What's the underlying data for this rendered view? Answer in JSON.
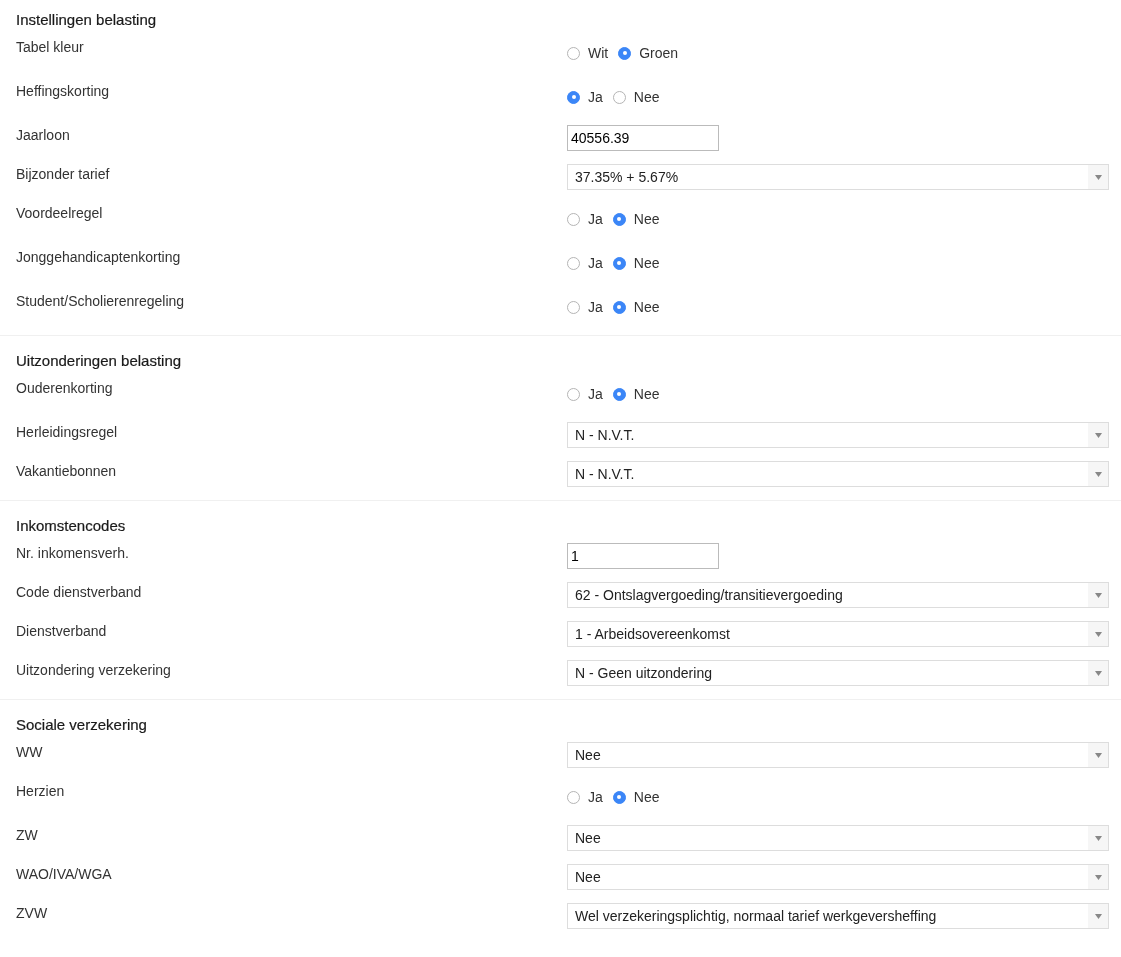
{
  "sections": [
    {
      "title": "Instellingen belasting",
      "rows": [
        {
          "label": "Tabel kleur",
          "kind": "radio",
          "options": [
            {
              "label": "Wit",
              "selected": false
            },
            {
              "label": "Groen",
              "selected": true
            }
          ]
        },
        {
          "label": "Heffingskorting",
          "kind": "radio",
          "options": [
            {
              "label": "Ja",
              "selected": true
            },
            {
              "label": "Nee",
              "selected": false
            }
          ]
        },
        {
          "label": "Jaarloon",
          "kind": "text",
          "value": "40556.39"
        },
        {
          "label": "Bijzonder tarief",
          "kind": "select",
          "value": "37.35% + 5.67%"
        },
        {
          "label": "Voordeelregel",
          "kind": "radio",
          "options": [
            {
              "label": "Ja",
              "selected": false
            },
            {
              "label": "Nee",
              "selected": true
            }
          ]
        },
        {
          "label": "Jonggehandicaptenkorting",
          "kind": "radio",
          "options": [
            {
              "label": "Ja",
              "selected": false
            },
            {
              "label": "Nee",
              "selected": true
            }
          ]
        },
        {
          "label": "Student/Scholierenregeling",
          "kind": "radio",
          "options": [
            {
              "label": "Ja",
              "selected": false
            },
            {
              "label": "Nee",
              "selected": true
            }
          ]
        }
      ]
    },
    {
      "title": "Uitzonderingen belasting",
      "rows": [
        {
          "label": "Ouderenkorting",
          "kind": "radio",
          "options": [
            {
              "label": "Ja",
              "selected": false
            },
            {
              "label": "Nee",
              "selected": true
            }
          ]
        },
        {
          "label": "Herleidingsregel",
          "kind": "select",
          "value": "N - N.V.T."
        },
        {
          "label": "Vakantiebonnen",
          "kind": "select",
          "value": "N - N.V.T."
        }
      ]
    },
    {
      "title": "Inkomstencodes",
      "rows": [
        {
          "label": "Nr. inkomensverh.",
          "kind": "text",
          "value": "1"
        },
        {
          "label": "Code dienstverband",
          "kind": "select",
          "value": "62 - Ontslagvergoeding/transitievergoeding"
        },
        {
          "label": "Dienstverband",
          "kind": "select",
          "value": "1 - Arbeidsovereenkomst"
        },
        {
          "label": "Uitzondering verzekering",
          "kind": "select",
          "value": "N - Geen uitzondering"
        }
      ]
    },
    {
      "title": "Sociale verzekering",
      "rows": [
        {
          "label": "WW",
          "kind": "select",
          "value": "Nee"
        },
        {
          "label": "Herzien",
          "kind": "radio",
          "options": [
            {
              "label": "Ja",
              "selected": false
            },
            {
              "label": "Nee",
              "selected": true
            }
          ]
        },
        {
          "label": "ZW",
          "kind": "select",
          "value": "Nee"
        },
        {
          "label": "WAO/IVA/WGA",
          "kind": "select",
          "value": "Nee"
        },
        {
          "label": "ZVW",
          "kind": "select",
          "value": "Wel verzekeringsplichtig, normaal tarief werkgeversheffing"
        }
      ]
    }
  ]
}
